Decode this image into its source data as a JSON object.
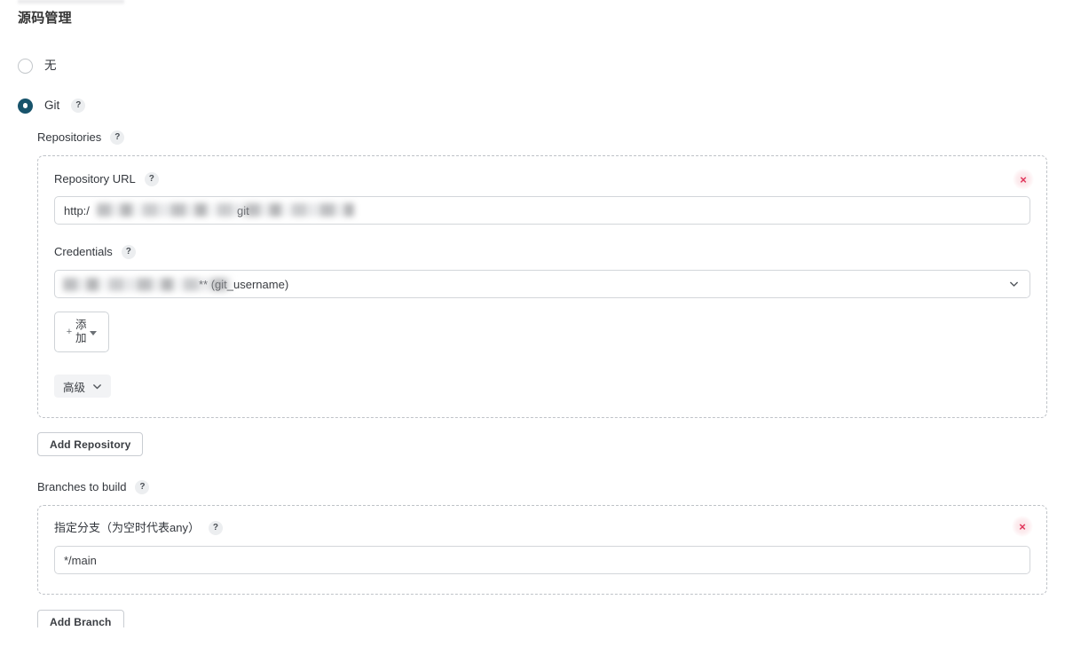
{
  "page": {
    "title": "源码管理"
  },
  "scm_options": [
    {
      "label": "无",
      "selected": false,
      "has_help": false
    },
    {
      "label": "Git",
      "selected": true,
      "has_help": true
    }
  ],
  "help_glyph": "?",
  "git": {
    "repositories": {
      "label": "Repositories",
      "repository": {
        "url_field": {
          "label": "Repository URL",
          "value": "http:/                                              git",
          "redacted": true
        },
        "credentials_field": {
          "label": "Credentials",
          "selected_value": "** (git_username)",
          "redacted": true
        },
        "add_credentials_button": {
          "plus": "+",
          "label": "添加"
        },
        "advanced_button": {
          "label": "高级"
        },
        "delete_button": "×"
      },
      "add_repository_button": "Add Repository"
    },
    "branches": {
      "label": "Branches to build",
      "branch": {
        "label": "指定分支（为空时代表any）",
        "value": "*/main",
        "delete_button": "×"
      },
      "add_branch_button": "Add Branch"
    }
  },
  "colors": {
    "radio_selected": "#17536b",
    "delete_x": "#e0355a",
    "dashed_border": "#bfc3c8",
    "input_border": "#d3d6da",
    "text_primary": "#33373d"
  }
}
